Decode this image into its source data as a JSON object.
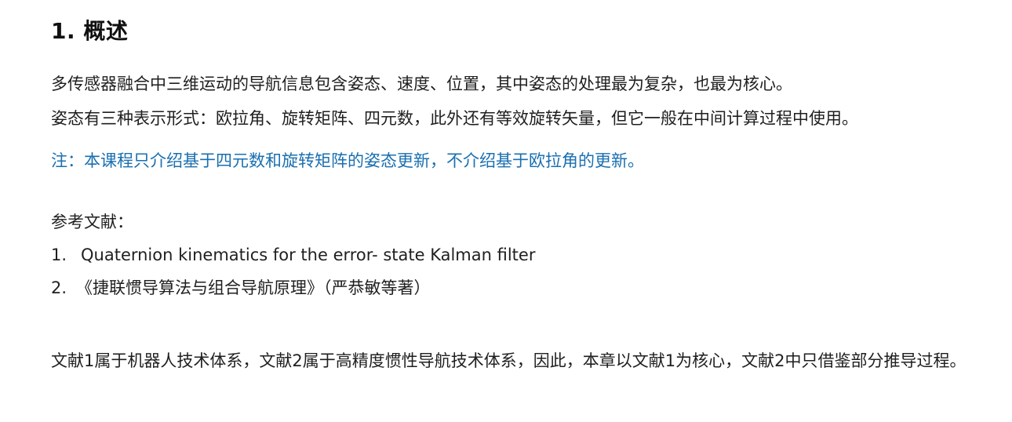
{
  "heading": "1. 概述",
  "paragraphs": [
    "多传感器融合中三维运动的导航信息包含姿态、速度、位置，其中姿态的处理最为复杂，也最为核心。",
    "姿态有三种表示形式：欧拉角、旋转矩阵、四元数，此外还有等效旋转矢量，但它一般在中间计算过程中使用。"
  ],
  "note": "注：本课程只介绍基于四元数和旋转矩阵的姿态更新，不介绍基于欧拉角的更新。",
  "references": {
    "title": "参考文献：",
    "items": [
      {
        "number": "1.",
        "text": "Quaternion kinematics for the error- state Kalman filter"
      },
      {
        "number": "2.",
        "text": "《捷联惯导算法与组合导航原理》（严恭敏等著）"
      }
    ]
  },
  "conclusion": "文献1属于机器人技术体系，文献2属于高精度惯性导航技术体系，因此，本章以文献1为核心，文献2中只借鉴部分推导过程。",
  "colors": {
    "text": "#1f1f1f",
    "heading": "#111111",
    "note": "#1a6fb0",
    "background": "#ffffff"
  }
}
